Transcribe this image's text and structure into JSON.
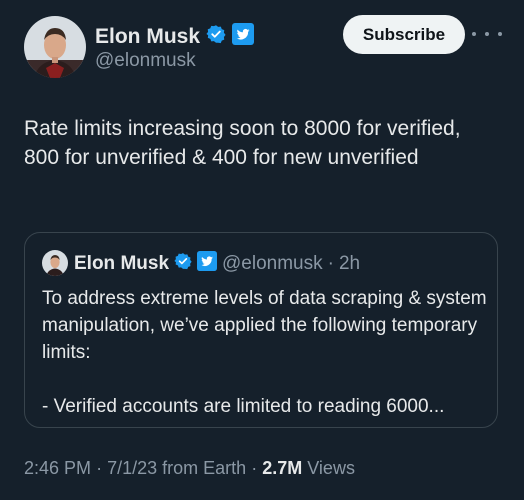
{
  "author": {
    "display_name": "Elon Musk",
    "handle": "@elonmusk",
    "verified_icon": "verified-badge-icon",
    "twitter_icon": "twitter-bird-icon"
  },
  "actions": {
    "subscribe_label": "Subscribe",
    "more_icon": "more-horizontal-icon"
  },
  "tweet": {
    "text": "Rate limits increasing soon to 8000 for verified, 800 for unverified & 400 for new unverified"
  },
  "quote": {
    "display_name": "Elon Musk",
    "handle": "@elonmusk",
    "separator": "·",
    "time": "2h",
    "text": "To address extreme levels of data scraping & system manipulation, we’ve applied the following temporary limits:\n\n- Verified accounts are limited to reading 6000..."
  },
  "meta": {
    "time": "2:46 PM",
    "date": "7/1/23",
    "source": "from Earth",
    "separator": "·",
    "views_count": "2.7M",
    "views_label": "Views"
  },
  "colors": {
    "background": "#15202b",
    "text": "#e7e9ea",
    "muted": "#8b98a5",
    "verified_blue": "#1d9bf0",
    "border": "#38444d"
  }
}
